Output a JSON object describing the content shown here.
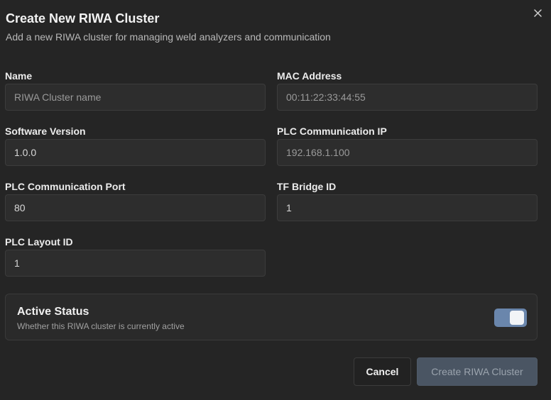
{
  "dialog": {
    "title": "Create New RIWA Cluster",
    "subtitle": "Add a new RIWA cluster for managing weld analyzers and communication",
    "close_icon": "close-icon"
  },
  "form": {
    "name": {
      "label": "Name",
      "value": "",
      "placeholder": "RIWA Cluster name"
    },
    "mac_address": {
      "label": "MAC Address",
      "value": "",
      "placeholder": "00:11:22:33:44:55"
    },
    "software_version": {
      "label": "Software Version",
      "value": "1.0.0",
      "placeholder": ""
    },
    "plc_ip": {
      "label": "PLC Communication IP",
      "value": "",
      "placeholder": "192.168.1.100"
    },
    "plc_port": {
      "label": "PLC Communication Port",
      "value": "80",
      "placeholder": ""
    },
    "tf_bridge_id": {
      "label": "TF Bridge ID",
      "value": "1",
      "placeholder": ""
    },
    "plc_layout_id": {
      "label": "PLC Layout ID",
      "value": "1",
      "placeholder": ""
    }
  },
  "active_status": {
    "title": "Active Status",
    "description": "Whether this RIWA cluster is currently active",
    "enabled": true
  },
  "actions": {
    "cancel_label": "Cancel",
    "create_label": "Create RIWA Cluster"
  },
  "colors": {
    "background": "#252525",
    "toggle_on": "#6a86ac",
    "create_button_disabled": "#4a5563"
  }
}
